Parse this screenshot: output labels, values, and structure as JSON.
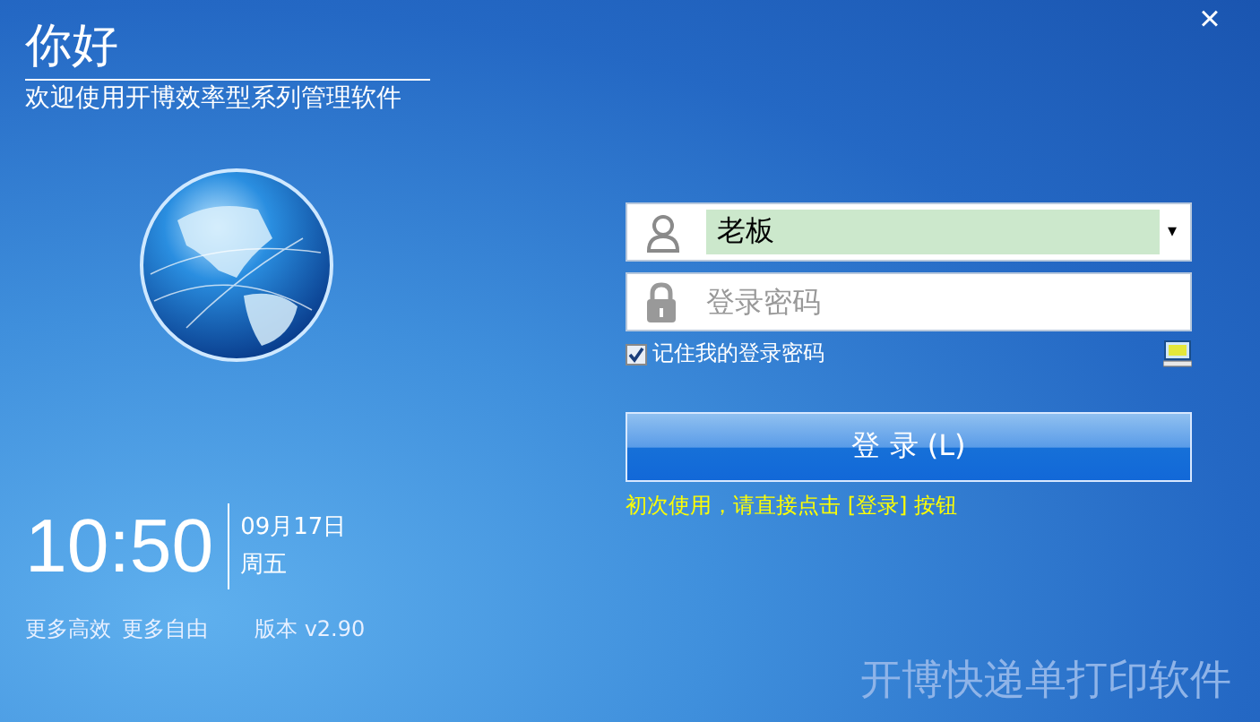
{
  "window": {
    "close": "×"
  },
  "greeting": {
    "title": "你好",
    "subtitle": "欢迎使用开博效率型系列管理软件"
  },
  "clock": {
    "time": "10:50",
    "date": "09月17日",
    "weekday": "周五"
  },
  "footer": {
    "slogans": [
      "更多高效",
      "更多自由"
    ],
    "version": "版本 v2.90"
  },
  "login": {
    "username": {
      "value": "老板",
      "dropdown": "▾"
    },
    "password": {
      "placeholder": "登录密码"
    },
    "remember": {
      "label": "记住我的登录密码",
      "checked": true
    },
    "button": "登 录 (L)",
    "hint": {
      "text": "初次使用，请直接点击 [登录] 按钮"
    }
  },
  "product_name": "开博快递单打印软件"
}
